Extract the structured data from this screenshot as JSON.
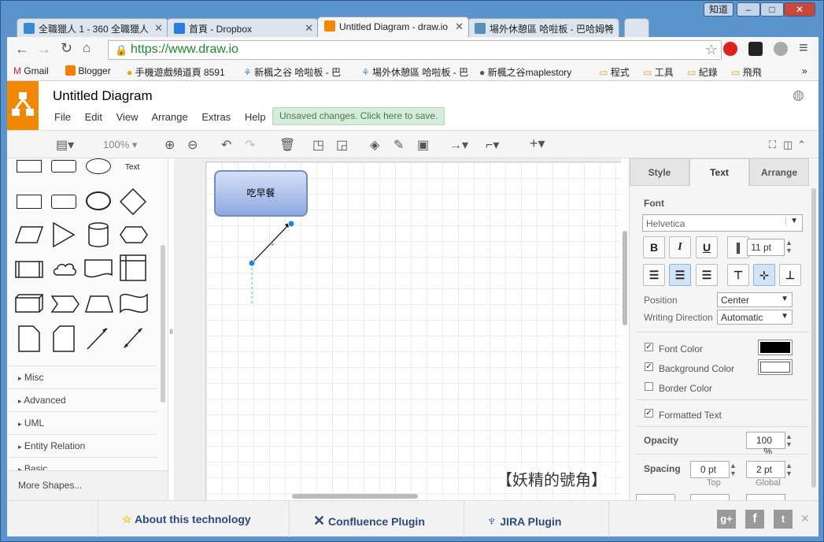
{
  "window": {
    "chinese_btn": "知道",
    "min": "‒",
    "max": "□",
    "close": "✕"
  },
  "tabs": [
    {
      "label": "全職獵人 1 - 360 全職獵人",
      "color": "#3b8bd4"
    },
    {
      "label": "首頁 - Dropbox",
      "color": "#2d7ce2"
    },
    {
      "label": "Untitled Diagram - draw.io",
      "color": "#f08705"
    },
    {
      "label": "場外休憩區 哈啦板 - 巴哈姆特",
      "color": "#5a8fb5"
    }
  ],
  "address": {
    "url": "https://www.draw.io"
  },
  "bookmarks": [
    "Gmail",
    "Blogger",
    "手機遊戲頻道頁 8591",
    "新楓之谷 哈啦板 - 巴",
    "場外休憩區 哈啦板 - 巴",
    "新楓之谷maplestory",
    "程式",
    "工具",
    "紀錄",
    "飛飛"
  ],
  "app": {
    "title": "Untitled Diagram",
    "menu": [
      "File",
      "Edit",
      "View",
      "Arrange",
      "Extras",
      "Help"
    ],
    "unsaved": "Unsaved changes. Click here to save.",
    "zoom": "100%"
  },
  "sidebar": {
    "text_shape": "Text",
    "sections": [
      "Misc",
      "Advanced",
      "UML",
      "Entity Relation",
      "Basic"
    ],
    "more": "More Shapes..."
  },
  "diagram": {
    "node_label": "吃早餐"
  },
  "panel": {
    "tabs": [
      "Style",
      "Text",
      "Arrange"
    ],
    "font_label": "Font",
    "font_value": "Helvetica",
    "font_size": "11 pt",
    "position_label": "Position",
    "position_value": "Center",
    "direction_label": "Writing Direction",
    "direction_value": "Automatic",
    "font_color": "Font Color",
    "bg_color": "Background Color",
    "border_color": "Border Color",
    "formatted_text": "Formatted Text",
    "opacity_label": "Opacity",
    "opacity_value": "100 %",
    "spacing_label": "Spacing",
    "spacing_top": "0 pt",
    "spacing_global": "2 pt",
    "top_label": "Top",
    "global_label": "Global",
    "font_color_hex": "#000000",
    "bg_color_hex": "#ffffff"
  },
  "footer": {
    "about": "About this technology",
    "confluence": "Confluence Plugin",
    "jira": "JIRA Plugin"
  },
  "watermark": "【妖精的號角】"
}
